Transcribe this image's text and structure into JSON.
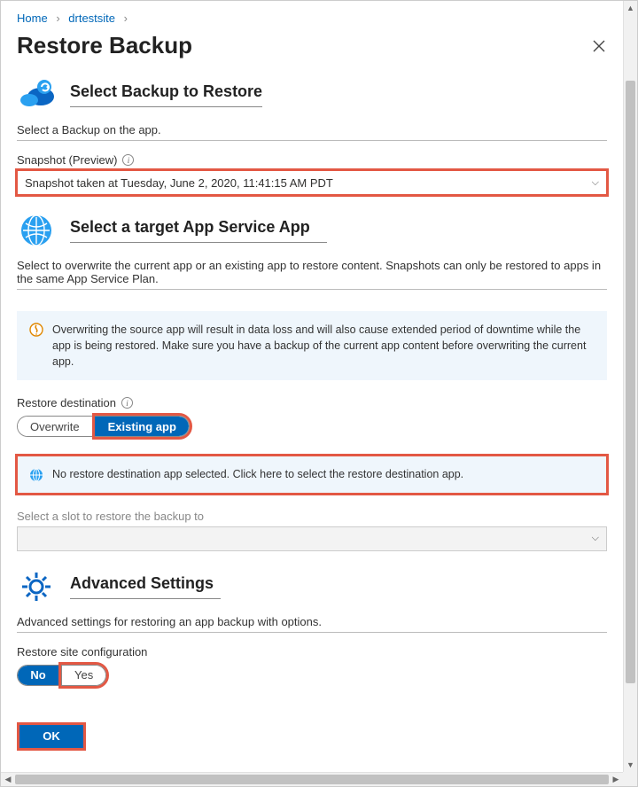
{
  "breadcrumb": {
    "home": "Home",
    "site": "drtestsite"
  },
  "page": {
    "title": "Restore Backup"
  },
  "section_backup": {
    "title": "Select Backup to Restore",
    "desc": "Select a Backup on the app.",
    "snapshot_label": "Snapshot (Preview)",
    "snapshot_value": "Snapshot taken at Tuesday, June 2, 2020, 11:41:15 AM PDT"
  },
  "section_target": {
    "title": "Select a target App Service App",
    "desc": "Select to overwrite the current app or an existing app to restore content. Snapshots can only be restored to apps in the same App Service Plan.",
    "warning": "Overwriting the source app will result in data loss and will also cause extended period of downtime while the app is being restored. Make sure you have a backup of the current app content before overwriting the current app.",
    "dest_label": "Restore destination",
    "dest_overwrite": "Overwrite",
    "dest_existing": "Existing app",
    "no_dest_msg": "No restore destination app selected. Click here to select the restore destination app.",
    "slot_label": "Select a slot to restore the backup to"
  },
  "section_advanced": {
    "title": "Advanced Settings",
    "desc": "Advanced settings for restoring an app backup with options.",
    "cfg_label": "Restore site configuration",
    "cfg_no": "No",
    "cfg_yes": "Yes"
  },
  "buttons": {
    "ok": "OK"
  }
}
